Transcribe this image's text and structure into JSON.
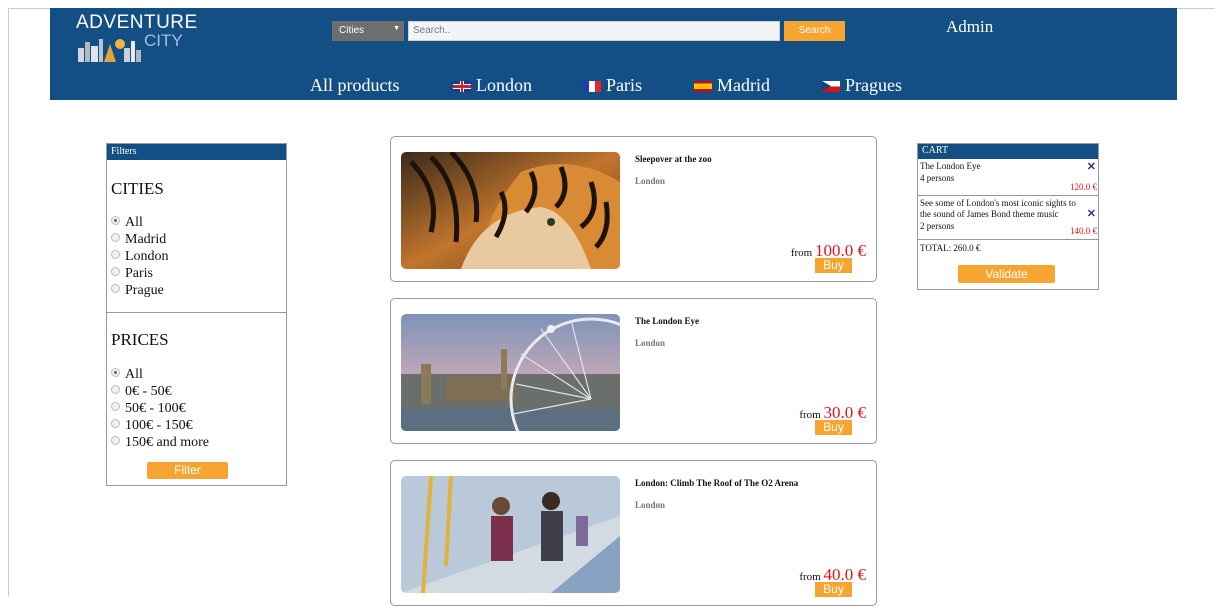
{
  "header": {
    "logo_line1": "ADVENTURE",
    "logo_line2": "CITY",
    "city_select": "Cities",
    "search_placeholder": "Search..",
    "search_button": "Search",
    "admin": "Admin"
  },
  "nav": [
    {
      "label": "All products",
      "flag": ""
    },
    {
      "label": "London",
      "flag": "uk"
    },
    {
      "label": "Paris",
      "flag": "fr"
    },
    {
      "label": "Madrid",
      "flag": "es"
    },
    {
      "label": "Pragues",
      "flag": "cz"
    }
  ],
  "filters": {
    "title": "Filters",
    "cities_heading": "CITIES",
    "cities": [
      "All",
      "Madrid",
      "London",
      "Paris",
      "Prague"
    ],
    "cities_selected": "All",
    "prices_heading": "PRICES",
    "prices": [
      "All",
      "0€ - 50€",
      "50€ - 100€",
      "100€ - 150€",
      "150€ and more"
    ],
    "prices_selected": "All",
    "button": "Filter"
  },
  "products": [
    {
      "name": "Sleepover at the zoo",
      "city": "London",
      "from": "from",
      "price": "100.0 €",
      "buy": "Buy",
      "image": "tiger-photo"
    },
    {
      "name": "The London Eye",
      "city": "London",
      "from": "from",
      "price": "30.0 €",
      "buy": "Buy",
      "image": "london-eye-photo"
    },
    {
      "name": "London: Climb The Roof of The O2 Arena",
      "city": "London",
      "from": "from",
      "price": "40.0 €",
      "buy": "Buy",
      "image": "o2-arena-photo"
    }
  ],
  "cart": {
    "title": "CART",
    "items": [
      {
        "name": "The London Eye",
        "persons": "4 persons",
        "price": "120.0 €"
      },
      {
        "name": "See some of London's most iconic sights to the sound of James Bond theme music",
        "persons": "2 persons",
        "price": "140.0 €"
      }
    ],
    "remove_icon": "✕",
    "total": "TOTAL: 260.0 €",
    "validate": "Validate"
  },
  "colors": {
    "header_bg": "#134f84",
    "accent": "#f7a531",
    "price": "#e1141b"
  }
}
